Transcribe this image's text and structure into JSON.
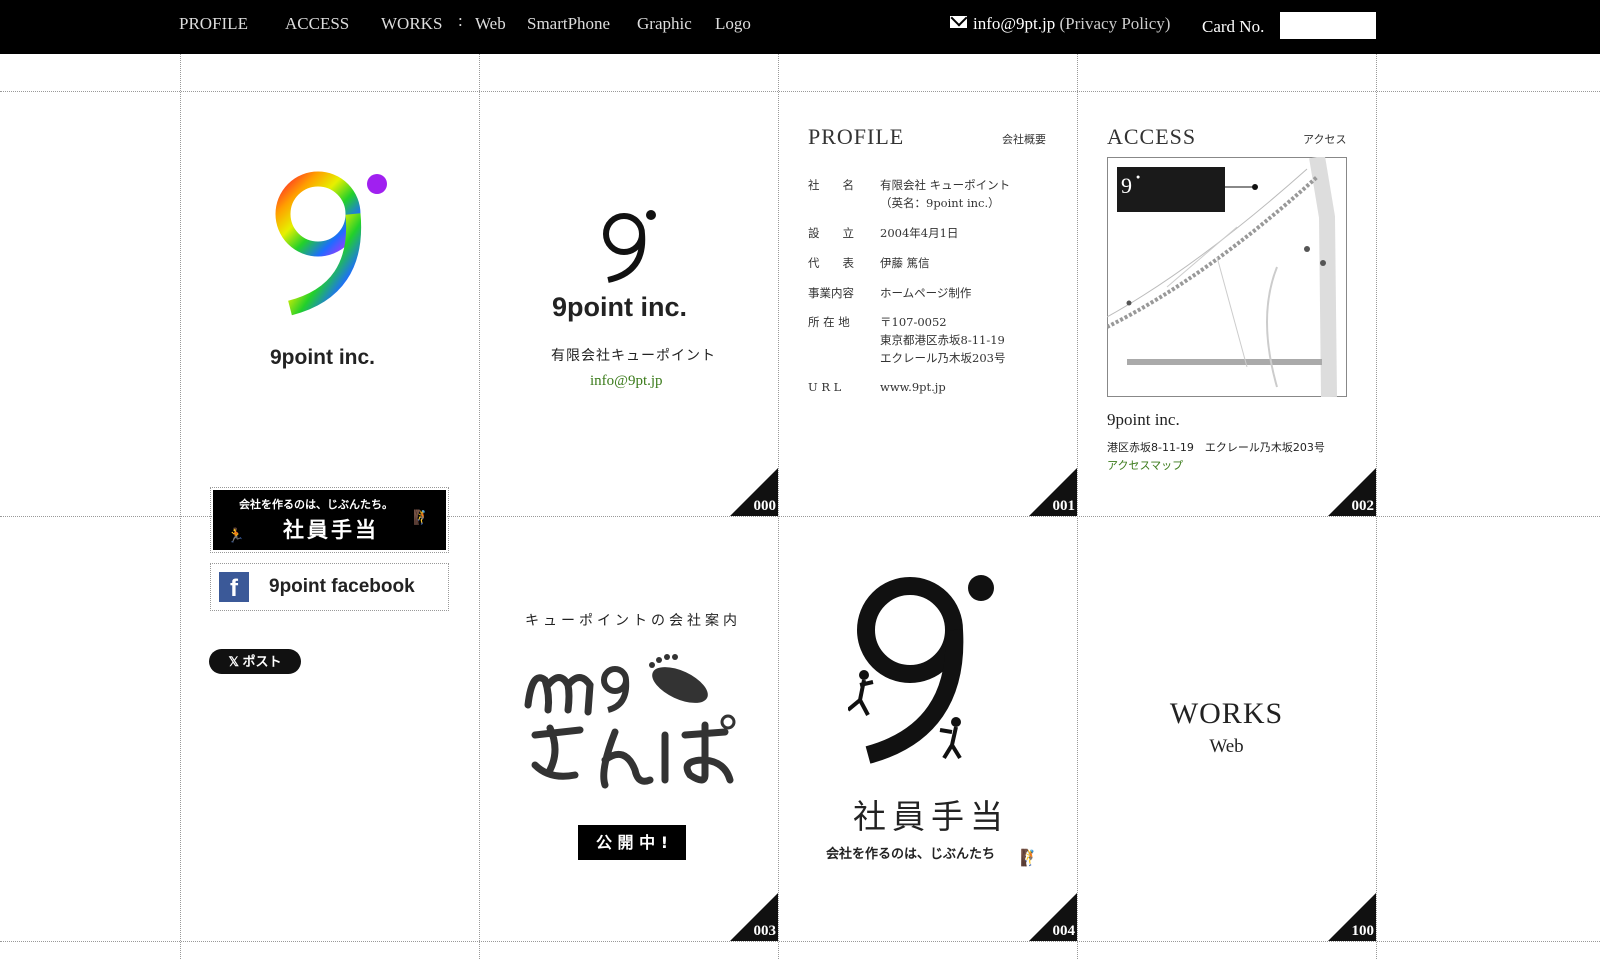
{
  "nav": {
    "profile": "PROFILE",
    "access": "ACCESS",
    "works": "WORKS",
    "sep": ":",
    "web": "Web",
    "smartphone": "SmartPhone",
    "graphic": "Graphic",
    "logo": "Logo"
  },
  "header": {
    "email": "info@9pt.jp",
    "privacy": "(Privacy Policy)",
    "card_label": "Card No.",
    "card_value": ""
  },
  "sidebar": {
    "logo_text": "9point inc.",
    "banner_shain": {
      "top": "会社を作るのは、じぶんたち。",
      "main": "社員手当"
    },
    "banner_facebook": "9point facebook",
    "post_label": "ポスト"
  },
  "cards": {
    "c000": {
      "number": "000",
      "logo_text": "9point inc.",
      "company_jp": "有限会社キューポイント",
      "email": "info@9pt.jp"
    },
    "c001": {
      "number": "001",
      "title": "PROFILE",
      "subtitle": "会社概要",
      "rows": [
        {
          "label": "社　　名",
          "value": "有限会社 キューポイント"
        },
        {
          "label": "",
          "value": "（英名：9point inc.）"
        },
        {
          "label": "設　　立",
          "value": "2004年4月1日"
        },
        {
          "label": "代　　表",
          "value": "伊藤 篤信"
        },
        {
          "label": "事業内容",
          "value": "ホームページ制作"
        },
        {
          "label": "所 在 地",
          "value": "〒107-0052"
        },
        {
          "label": "",
          "value": "東京都港区赤坂8-11-19"
        },
        {
          "label": "",
          "value": "エクレール乃木坂203号"
        },
        {
          "label": "U R L",
          "value": "www.9pt.jp"
        }
      ]
    },
    "c002": {
      "number": "002",
      "title": "ACCESS",
      "subtitle": "アクセス",
      "company": "9point inc.",
      "address": "港区赤坂8-11-19　エクレール乃木坂203号",
      "map_link": "アクセスマップ"
    },
    "c003": {
      "number": "003",
      "tagline": "キューポイントの会社案内",
      "badge": "公 開 中 !"
    },
    "c004": {
      "number": "004",
      "title": "社員手当",
      "tagline": "会社を作るのは、じぶんたち"
    },
    "c100": {
      "number": "100",
      "title": "WORKS",
      "subtitle": "Web"
    }
  }
}
